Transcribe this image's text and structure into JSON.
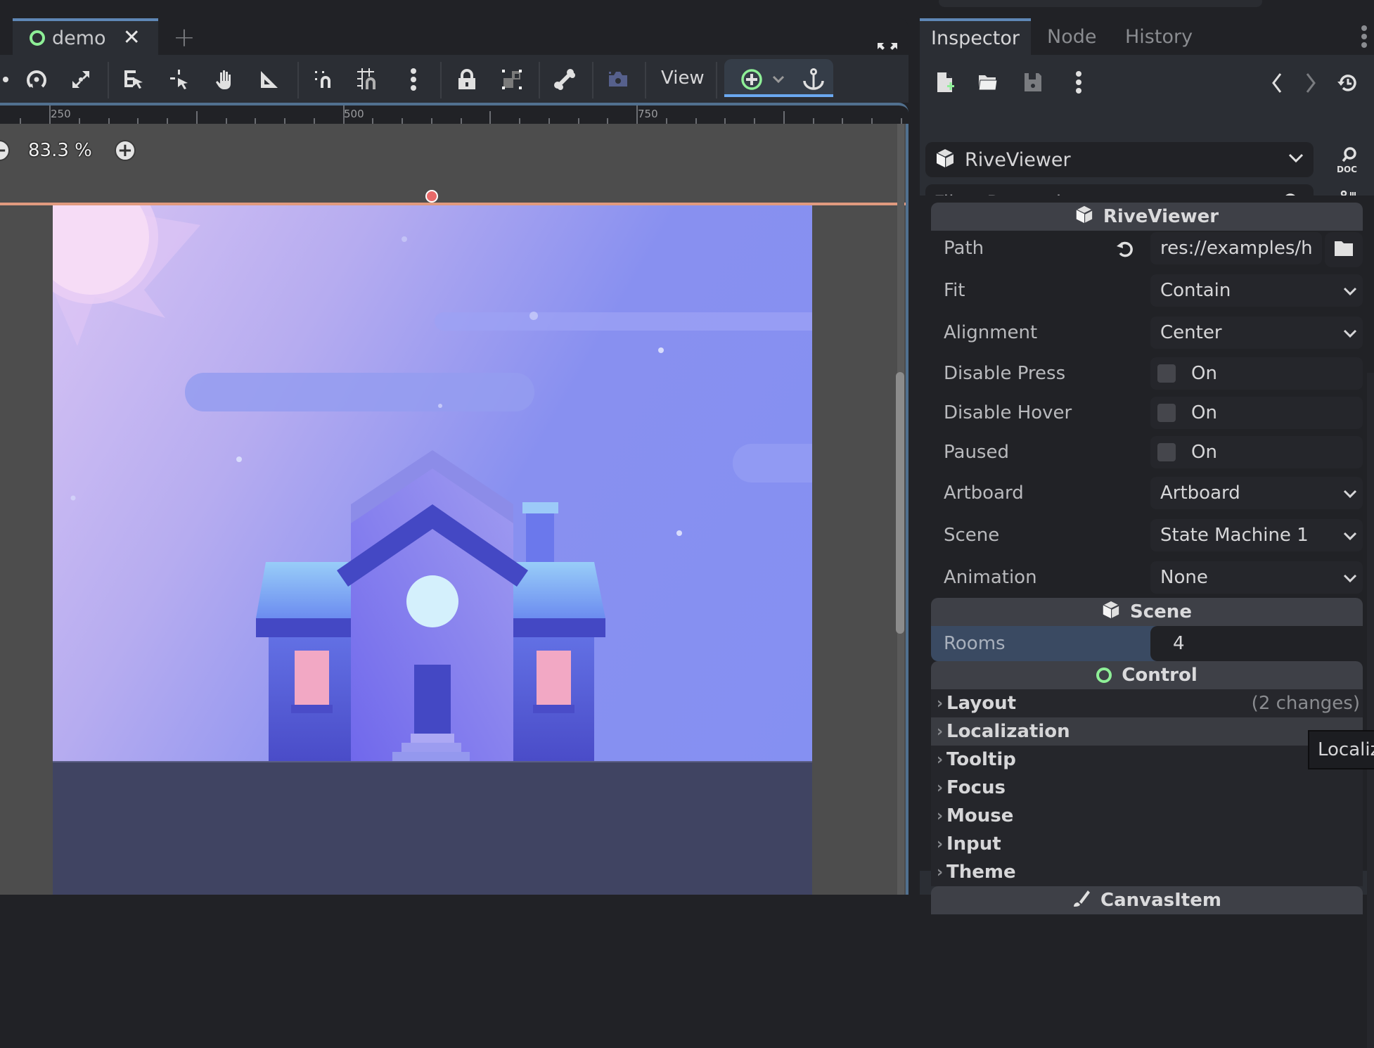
{
  "editor": {
    "scene_tab": {
      "label": "demo",
      "icon": "control-node-ring-icon",
      "close_icon": "close-icon"
    },
    "add_tab_icon": "plus-icon",
    "fullscreen_icon": "fullscreen-icon",
    "toolbar": {
      "icons": [
        "rotate-mode-icon",
        "scale-mode-icon",
        "list-select-icon",
        "select-icon",
        "pan-hand-icon",
        "ruler-icon",
        "smart-snap-icon",
        "grid-snap-icon",
        "more-vertical-icon",
        "lock-icon",
        "group-icon",
        "bone-icon",
        "camera-icon",
        "add-node-icon",
        "chevron-down-icon",
        "anchor-icon"
      ],
      "view_label": "View"
    },
    "ruler": {
      "labels": [
        "250",
        "500",
        "750"
      ]
    },
    "zoom": {
      "value": "83.3 %",
      "zoom_out_icon": "minus-icon",
      "zoom_in_icon": "plus-icon"
    }
  },
  "inspector": {
    "tabs": [
      {
        "label": "Inspector",
        "active": true
      },
      {
        "label": "Node",
        "active": false
      },
      {
        "label": "History",
        "active": false
      }
    ],
    "toolbar_icons": [
      "new-resource-icon",
      "open-folder-icon",
      "save-icon",
      "more-vertical-icon",
      "back-icon",
      "forward-icon",
      "history-icon"
    ],
    "object_select": {
      "value": "RiveViewer",
      "icon": "cube-icon",
      "doc_icon": "doc-search-icon"
    },
    "filter": {
      "placeholder": "Filter Properties",
      "value": "",
      "tools_icon": "tools-icon"
    },
    "sections": {
      "riveviewer": {
        "title": "RiveViewer",
        "icon": "cube-icon"
      },
      "scene": {
        "title": "Scene",
        "icon": "cube-icon"
      },
      "control": {
        "title": "Control",
        "icon": "control-node-ring-icon"
      },
      "canvasitem": {
        "title": "CanvasItem",
        "icon": "brush-icon"
      }
    },
    "properties": {
      "path": {
        "label": "Path",
        "value": "res://examples/h"
      },
      "fit": {
        "label": "Fit",
        "value": "Contain"
      },
      "alignment": {
        "label": "Alignment",
        "value": "Center"
      },
      "disable_press": {
        "label": "Disable Press",
        "checked": false,
        "text": "On"
      },
      "disable_hover": {
        "label": "Disable Hover",
        "checked": false,
        "text": "On"
      },
      "paused": {
        "label": "Paused",
        "checked": false,
        "text": "On"
      },
      "artboard": {
        "label": "Artboard",
        "value": "Artboard"
      },
      "scene": {
        "label": "Scene",
        "value": "State Machine 1"
      },
      "animation": {
        "label": "Animation",
        "value": "None"
      },
      "rooms": {
        "label": "Rooms",
        "value": "4"
      }
    },
    "groups": [
      {
        "label": "Layout",
        "extra": "(2 changes)"
      },
      {
        "label": "Localization",
        "extra": ""
      },
      {
        "label": "Tooltip",
        "extra": ""
      },
      {
        "label": "Focus",
        "extra": ""
      },
      {
        "label": "Mouse",
        "extra": ""
      },
      {
        "label": "Input",
        "extra": ""
      },
      {
        "label": "Theme",
        "extra": ""
      }
    ],
    "tooltip": "Localiz"
  },
  "colors": {
    "accent": "#5f87b6",
    "control_green": "#8eef97",
    "pivot_red": "#e86a6a",
    "guide_orange": "#e09a7f"
  }
}
